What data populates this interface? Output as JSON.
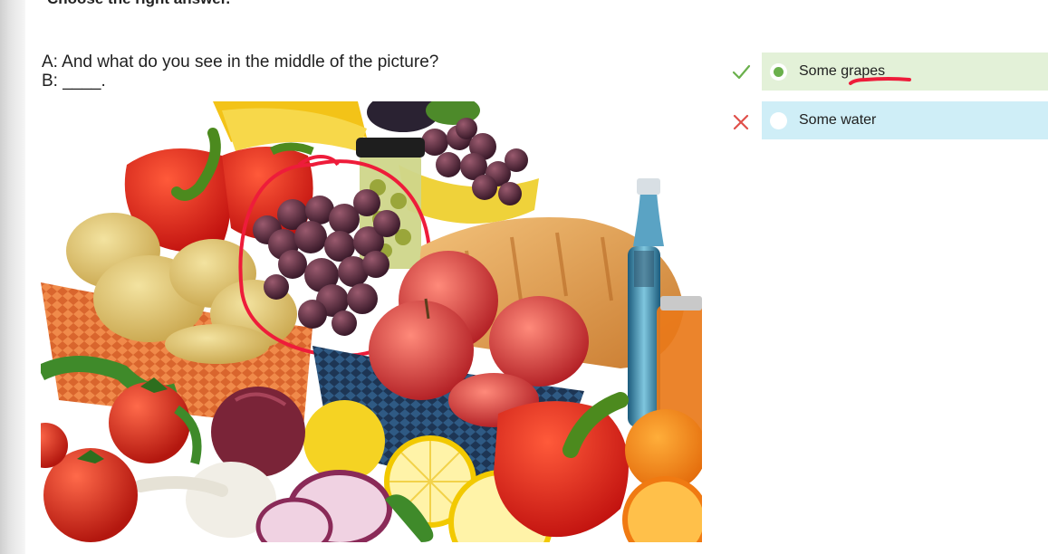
{
  "header": {
    "instruction": "Choose the right answer."
  },
  "question": {
    "line_a": "A: And what do you see in the middle of the picture?",
    "line_b": "B: ____."
  },
  "answers": [
    {
      "label": "Some grapes",
      "status": "correct",
      "selected": true,
      "mark_icon": "check-icon",
      "mark_color": "#6ab04c",
      "bg": "#e3f1d8"
    },
    {
      "label": "Some water",
      "status": "incorrect",
      "selected": false,
      "mark_icon": "cross-icon",
      "mark_color": "#e0504a",
      "bg": "#cfeef7"
    }
  ],
  "colors": {
    "annotation_red": "#ee1c3a"
  }
}
